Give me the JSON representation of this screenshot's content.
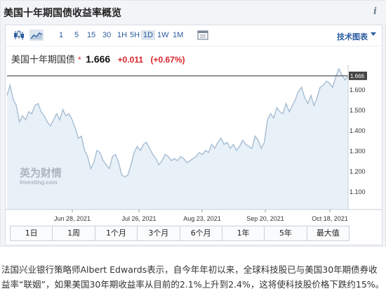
{
  "widget": {
    "title": "美国十年期国债收益率概览",
    "info_icon": "i"
  },
  "toolbar": {
    "icons": [
      "candlestick-icon",
      "area-chart-icon",
      "calendar-icon"
    ],
    "timeframes": [
      "1",
      "5",
      "15",
      "30",
      "1H",
      "5H",
      "1D",
      "1W",
      "1M"
    ],
    "active_timeframe": "1D",
    "tech_link": "技术图表"
  },
  "quote": {
    "name": "美国十年期国债",
    "star": "*",
    "price": "1.666",
    "change": "+0.011",
    "change_pct": "(+0.67%)"
  },
  "watermark": {
    "brand": "英为财情",
    "sub": "Investing.com"
  },
  "chart_data": {
    "type": "area",
    "x_tick_labels": [
      "Jun 28, 2021",
      "Jul 26, 2021",
      "Aug 23, 2021",
      "Sep 20, 2021",
      "Oct 18, 2021"
    ],
    "y_tick_labels": [
      "1.100",
      "1.200",
      "1.300",
      "1.400",
      "1.500",
      "1.600"
    ],
    "ylim": [
      1.1,
      1.66
    ],
    "current_value_label": "1.666",
    "current_value": 1.666,
    "grid": false,
    "line_color": "#a7bdd2",
    "fill_color": "#e8f0f8",
    "values": [
      1.57,
      1.62,
      1.55,
      1.52,
      1.44,
      1.47,
      1.45,
      1.49,
      1.48,
      1.52,
      1.53,
      1.49,
      1.47,
      1.44,
      1.42,
      1.45,
      1.48,
      1.45,
      1.5,
      1.47,
      1.48,
      1.45,
      1.41,
      1.36,
      1.37,
      1.3,
      1.27,
      1.21,
      1.24,
      1.3,
      1.29,
      1.25,
      1.23,
      1.21,
      1.27,
      1.28,
      1.24,
      1.18,
      1.17,
      1.18,
      1.23,
      1.29,
      1.32,
      1.3,
      1.33,
      1.34,
      1.31,
      1.28,
      1.26,
      1.23,
      1.25,
      1.28,
      1.27,
      1.25,
      1.26,
      1.25,
      1.27,
      1.26,
      1.24,
      1.25,
      1.26,
      1.27,
      1.29,
      1.28,
      1.3,
      1.29,
      1.33,
      1.31,
      1.34,
      1.36,
      1.33,
      1.34,
      1.31,
      1.33,
      1.3,
      1.32,
      1.35,
      1.33,
      1.32,
      1.31,
      1.37,
      1.35,
      1.31,
      1.34,
      1.45,
      1.48,
      1.46,
      1.51,
      1.49,
      1.48,
      1.53,
      1.49,
      1.52,
      1.55,
      1.59,
      1.61,
      1.56,
      1.53,
      1.57,
      1.52,
      1.56,
      1.61,
      1.62,
      1.64,
      1.63,
      1.61,
      1.66,
      1.7,
      1.67,
      1.646,
      1.666
    ]
  },
  "range_buttons": [
    "1日",
    "1周",
    "1个月",
    "3个月",
    "6个月",
    "1年",
    "5年",
    "最大值"
  ],
  "caption": "法国兴业银行策略师Albert Edwards表示，自今年年初以来，全球科技股已与美国30年期债券收益率“联姻”，如果美国30年期收益率从目前的2.1%上升到2.4%，这将使科技股价格下跌约15%。",
  "colors": {
    "up_red": "#d9242b",
    "link_blue": "#2a5d9f",
    "panel_bg": "#f2f4f7"
  }
}
